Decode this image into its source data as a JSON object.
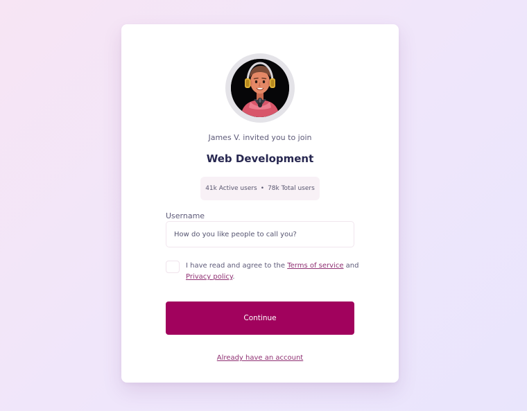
{
  "colors": {
    "page_background_start": "#f7e5f4",
    "page_background_end": "#e9e5fc",
    "card": "#ffffff",
    "primary_button": "#a1025d",
    "link": "#8f2f72",
    "title_text": "#272750",
    "stats_background": "#f8f1f6"
  },
  "invite": {
    "avatar_icon": "person-with-headphones-avatar",
    "invited_text": "James V. invited you to join",
    "community_name": "Web Development"
  },
  "stats": {
    "active_users": "41k Active users",
    "separator": "•",
    "total_users": "78k Total users"
  },
  "form": {
    "username_label": "Username",
    "username_value": "",
    "username_placeholder": "How do you like people to call you?",
    "agree_checked": false,
    "agree_prefix": "I have read and agree to the ",
    "terms_link": "Terms of service",
    "agree_conjunction": " and ",
    "privacy_link": "Privacy policy",
    "agree_suffix": ".",
    "continue_label": "Continue",
    "account_link": "Already have an account"
  }
}
